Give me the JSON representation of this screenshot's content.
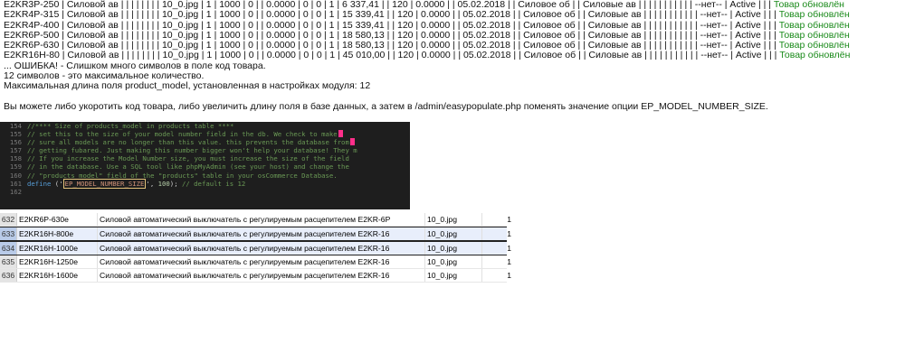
{
  "import_log": {
    "rows": [
      {
        "text": "E2KR3P-250 | Силовой ав | | | | | | | | 10_0.jpg | 1 | 1000 | 0 | | 0.0000 | 0 | 0 | 1 | 6 337,41 | | 120 | 0.0000 | | 05.02.2018 | | Силовое об | | Силовые ав | | | | | | | | | | | --нет-- | Active | | | ",
        "status": "Товар обновлён"
      },
      {
        "text": "E2KR4P-315 | Силовой ав | | | | | | | | 10_0.jpg | 1 | 1000 | 0 | | 0.0000 | 0 | 0 | 1 | 15 339,41 | | 120 | 0.0000 | | 05.02.2018 | | Силовое об | | Силовые ав | | | | | | | | | | | --нет-- | Active | | | ",
        "status": "Товар обновлён"
      },
      {
        "text": "E2KR4P-400 | Силовой ав | | | | | | | | 10_0.jpg | 1 | 1000 | 0 | | 0.0000 | 0 | 0 | 1 | 15 339,41 | | 120 | 0.0000 | | 05.02.2018 | | Силовое об | | Силовые ав | | | | | | | | | | | --нет-- | Active | | | ",
        "status": "Товар обновлён"
      },
      {
        "text": "E2KR6P-500 | Силовой ав | | | | | | | | 10_0.jpg | 1 | 1000 | 0 | | 0.0000 | 0 | 0 | 1 | 18 580,13 | | 120 | 0.0000 | | 05.02.2018 | | Силовое об | | Силовые ав | | | | | | | | | | | --нет-- | Active | | | ",
        "status": "Товар обновлён"
      },
      {
        "text": "E2KR6P-630 | Силовой ав | | | | | | | | 10_0.jpg | 1 | 1000 | 0 | | 0.0000 | 0 | 0 | 1 | 18 580,13 | | 120 | 0.0000 | | 05.02.2018 | | Силовое об | | Силовые ав | | | | | | | | | | | --нет-- | Active | | | ",
        "status": "Товар обновлён"
      },
      {
        "text": "E2KR16H-80 | Силовой ав | | | | | | | | 10_0.jpg | 1 | 1000 | 0 | | 0.0000 | 0 | 0 | 1 | 45 010,00 | | 120 | 0.0000 | | 05.02.2018 | | Силовое об | | Силовые ав | | | | | | | | | | | --нет-- | Active | | | ",
        "status": "Товар обновлён"
      }
    ],
    "error_line": "... ОШИБКА! - Слишком много символов в поле код товара.",
    "max_chars_line": "12 символов - это максимальное количество.",
    "module_setting_line": "Максимальная длина поля product_model, установленная в настройках модуля: 12",
    "advice_line": "Вы можете либо укоротить код товара, либо увеличить длину поля в базе данных, а затем в /admin/easypopulate.php поменять значение опции EP_MODEL_NUMBER_SIZE."
  },
  "code_editor": {
    "lines": [
      {
        "num": "154",
        "text": "//**** Size of products_model in products table ****"
      },
      {
        "num": "155",
        "text": "// set this to the size of your model number field in the db.  We check to make"
      },
      {
        "num": "156",
        "text": "// sure all models are no longer than this value. this prevents the database from"
      },
      {
        "num": "157",
        "text": "// getting fubared.  Just making this number bigger won't help your database!  They m"
      },
      {
        "num": "158",
        "text": "// If you increase the Model Number size, you must increase the size of the field"
      },
      {
        "num": "159",
        "text": "// in the database. Use a SQL tool like phpMyAdmin (see your host) and change the"
      },
      {
        "num": "160",
        "text": "// \"products_model\" field of the \"products\" table in your osCommerce Database."
      }
    ],
    "define_line": {
      "num": "161",
      "keyword": "define",
      "open": " ('",
      "constant": "EP_MODEL_NUMBER_SIZE",
      "close": "', ",
      "value": "100",
      "end": ");",
      "comment": " // default is 12"
    },
    "last_line_num": "162"
  },
  "spreadsheet": {
    "rows": [
      {
        "row": "632",
        "model": "E2KR6P-630e",
        "name": "Силовой автоматический выключатель  с регулируемым расцепителем E2KR-6P",
        "image": "10_0.jpg",
        "qty": "1",
        "selected": false
      },
      {
        "row": "633",
        "model": "E2KR16H-800e",
        "name": "Силовой автоматический выключатель  с регулируемым расцепителем E2KR-16",
        "image": "10_0.jpg",
        "qty": "1",
        "selected": true
      },
      {
        "row": "634",
        "model": "E2KR16H-1000e",
        "name": "Силовой автоматический выключатель  с регулируемым расцепителем E2KR-16",
        "image": "10_0.jpg",
        "qty": "1",
        "selected": true
      },
      {
        "row": "635",
        "model": "E2KR16H-1250e",
        "name": "Силовой автоматический выключатель  с регулируемым расцепителем E2KR-16",
        "image": "10_0.jpg",
        "qty": "1",
        "selected": false
      },
      {
        "row": "636",
        "model": "E2KR16H-1600e",
        "name": "Силовой автоматический выключатель  с регулируемым расцепителем E2KR-16",
        "image": "10_0.jpg",
        "qty": "1",
        "selected": false
      }
    ]
  }
}
